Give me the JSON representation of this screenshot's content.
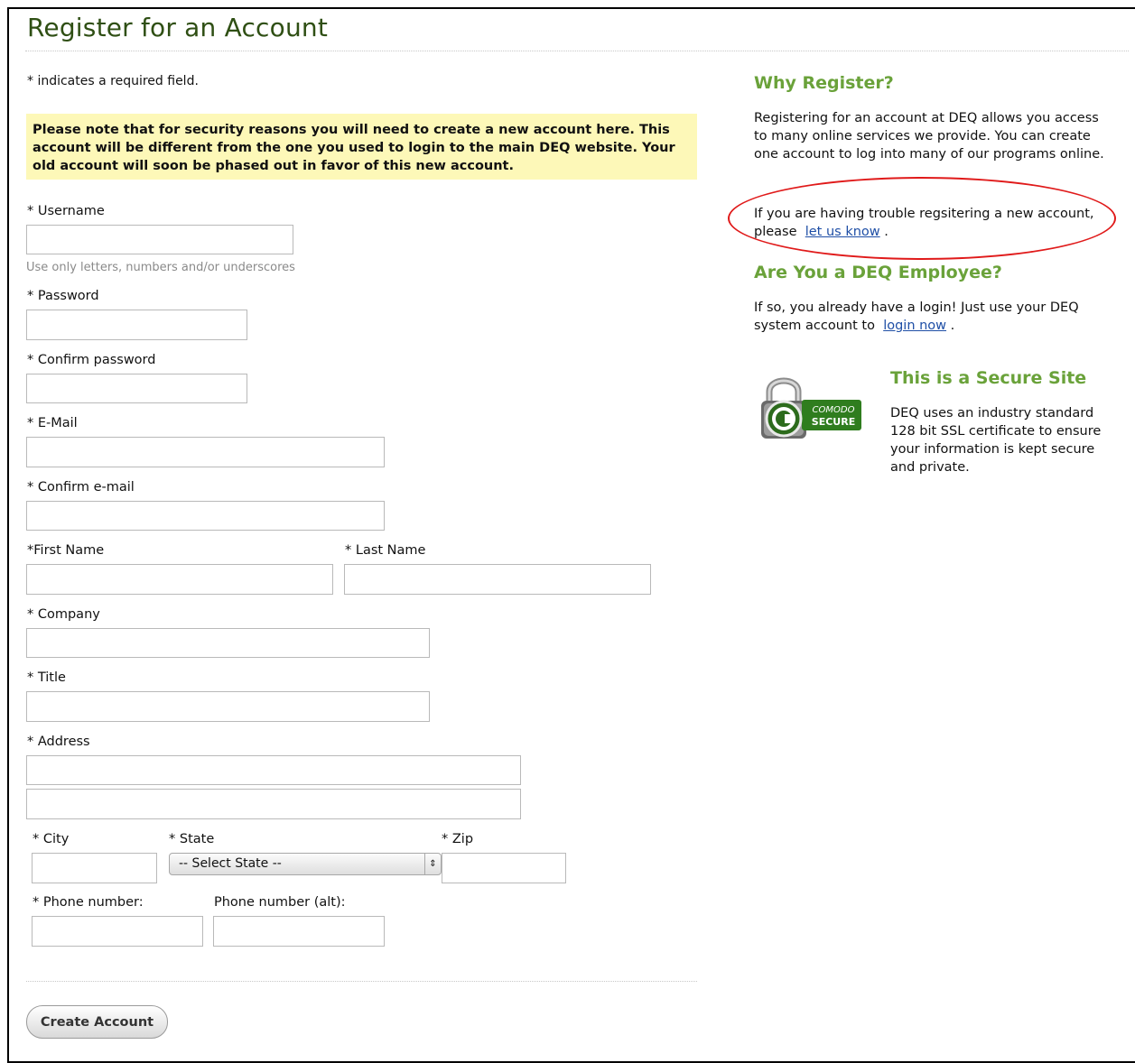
{
  "page": {
    "title": "Register for an Account"
  },
  "form": {
    "required_note": "* indicates a required field.",
    "notice": "Please note that for security reasons you will need to create a new account here. This account will be different from the one you used to login to the main DEQ website. Your old account will soon be phased out in favor of this new account.",
    "username_label": "* Username",
    "username_hint": "Use only letters, numbers and/or underscores",
    "password_label": "* Password",
    "confirm_password_label": "* Confirm password",
    "email_label": "* E-Mail",
    "confirm_email_label": "* Confirm e-mail",
    "first_name_label": "*First Name",
    "last_name_label": "* Last Name",
    "company_label": "* Company",
    "title_label": "* Title",
    "address_label": "* Address",
    "city_label": "* City",
    "state_label": "* State",
    "state_selected": "-- Select State --",
    "zip_label": "* Zip",
    "phone_label": "* Phone number:",
    "phone_alt_label": "Phone number (alt):",
    "submit_label": "Create Account"
  },
  "sidebar": {
    "why_heading": "Why Register?",
    "why_text": "Registering for an account at DEQ allows you access to many online services we provide. You can create one account to log into many of our programs online.",
    "trouble_text": "If you are having trouble regsitering a new account, please",
    "trouble_link": "let us know",
    "trouble_end": ".",
    "employee_heading": "Are You a DEQ Employee?",
    "employee_text": "If so, you already have a login! Just use your DEQ system account to",
    "employee_link": "login now",
    "employee_end": ".",
    "secure_heading": "This is a Secure Site",
    "secure_text": "DEQ uses an industry standard 128 bit SSL certificate to ensure your information is kept secure and private.",
    "badge_line1": "COMODO",
    "badge_line2": "SECURE"
  },
  "colors": {
    "title": "#2f4f14",
    "heading_green": "#6aa23a",
    "notice_bg": "#fdf8b8",
    "link": "#1f4fa6",
    "annotation_red": "#e01a1a"
  },
  "icons": {
    "badge": "padlock-icon"
  }
}
